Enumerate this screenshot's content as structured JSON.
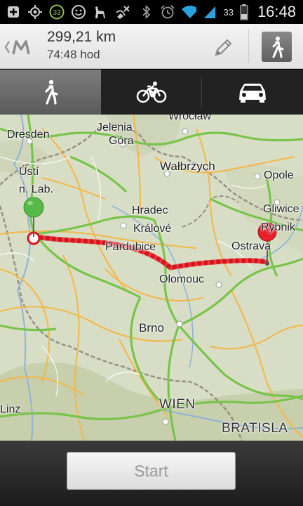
{
  "status_bar": {
    "notification_count": "33",
    "battery_percent": "33",
    "time": "16:48"
  },
  "header": {
    "distance": "299,21 km",
    "duration": "74:48 hod"
  },
  "modes": [
    {
      "name": "walking",
      "active": true
    },
    {
      "name": "bicycling",
      "active": false
    },
    {
      "name": "driving",
      "active": false
    }
  ],
  "map": {
    "labels": {
      "dresden": "Dresden",
      "jelenia": "Jelenia",
      "gora": "Góra",
      "wroclaw": "Wrocław",
      "usti": "Ústí",
      "usti2": "n. Lab.",
      "walbrzych": "Wałbrzych",
      "opole": "Opole",
      "hradec": "Hradec",
      "kralove": "Králové",
      "gliwice": "Gliwice",
      "rybnik": "Rybnik",
      "pardubice": "Pardubice",
      "ostrava": "Ostrava",
      "olomouc": "Olomouc",
      "brno": "Brno",
      "linz": "Linz",
      "wien": "WIEN",
      "bratislava": "BRATISLA"
    },
    "route_color": "#e8202a",
    "start_pin_color": "#57b947",
    "end_pin_color": "#e8202a"
  },
  "bottom": {
    "start_label": "Start"
  }
}
